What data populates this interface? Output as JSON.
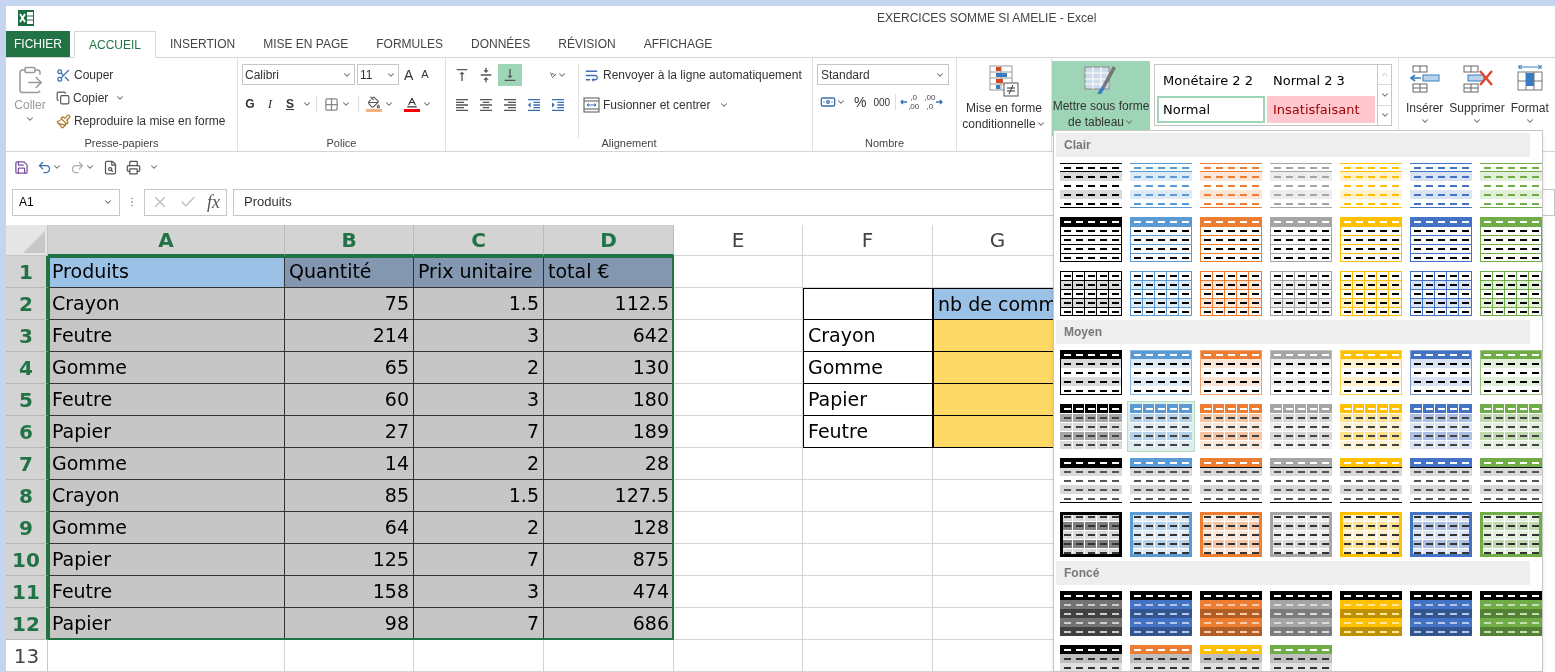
{
  "window": {
    "title": "EXERCICES SOMME SI AMELIE - Excel"
  },
  "tabs": [
    {
      "label": "FICHIER",
      "kind": "file",
      "selected": false
    },
    {
      "label": "ACCUEIL",
      "kind": "tab",
      "selected": true
    },
    {
      "label": "INSERTION",
      "kind": "tab",
      "selected": false
    },
    {
      "label": "MISE EN PAGE",
      "kind": "tab",
      "selected": false
    },
    {
      "label": "FORMULES",
      "kind": "tab",
      "selected": false
    },
    {
      "label": "DONNÉES",
      "kind": "tab",
      "selected": false
    },
    {
      "label": "RÉVISION",
      "kind": "tab",
      "selected": false
    },
    {
      "label": "AFFICHAGE",
      "kind": "tab",
      "selected": false
    }
  ],
  "ribbon": {
    "clipboard": {
      "label": "Presse-papiers",
      "paste": {
        "label": "Coller",
        "disabled": true
      },
      "cut": "Couper",
      "copy": "Copier",
      "format_painter": "Reproduire la mise en forme"
    },
    "font": {
      "label": "Police",
      "family": "Calibri",
      "size": "11",
      "grow": "A",
      "shrink": "A",
      "bold": "G",
      "italic": "I",
      "underline": "S"
    },
    "alignment": {
      "label": "Alignement",
      "vertical": [
        {
          "kind": "top",
          "selected": false
        },
        {
          "kind": "middle",
          "selected": false
        },
        {
          "kind": "bottom",
          "selected": true
        }
      ],
      "wrap": "Renvoyer à la ligne automatiquement",
      "merge": "Fusionner et centrer"
    },
    "number": {
      "label": "Nombre",
      "format": "Standard",
      "percent": "%",
      "thousands": "000",
      "decimals": [
        {
          "kind": "increase",
          "top": ",0",
          "bottom": ",00"
        },
        {
          "kind": "decrease",
          "top": ",00",
          "bottom": ",0"
        }
      ]
    },
    "conditional_format": {
      "lines": [
        "Mise en forme",
        "conditionnelle"
      ]
    },
    "format_as_table": {
      "lines": [
        "Mettre sous forme",
        "de tableau"
      ],
      "expanded": true
    },
    "cell_styles": [
      {
        "label": "Monétaire 2 2",
        "kind": "plain",
        "selected": false
      },
      {
        "label": "Normal 2 3",
        "kind": "plain",
        "selected": false
      },
      {
        "label": "Normal",
        "kind": "plain",
        "selected": true
      },
      {
        "label": "Insatisfaisant",
        "kind": "bad",
        "selected": false
      }
    ],
    "cells": [
      {
        "label": "Insérer",
        "kind": "insert"
      },
      {
        "label": "Supprimer",
        "kind": "delete"
      },
      {
        "label": "Format",
        "kind": "format"
      }
    ]
  },
  "formula_bar": {
    "name_box": "A1",
    "fx": "fx",
    "value": "Produits"
  },
  "sheet": {
    "columns": [
      {
        "label": "A",
        "selected": true
      },
      {
        "label": "B",
        "selected": true
      },
      {
        "label": "C",
        "selected": true
      },
      {
        "label": "D",
        "selected": true
      },
      {
        "label": "E",
        "selected": false
      },
      {
        "label": "F",
        "selected": false
      },
      {
        "label": "G",
        "selected": false
      }
    ],
    "rows": [
      {
        "label": "1",
        "selected": true
      },
      {
        "label": "2",
        "selected": true
      },
      {
        "label": "3",
        "selected": true
      },
      {
        "label": "4",
        "selected": true
      },
      {
        "label": "5",
        "selected": true
      },
      {
        "label": "6",
        "selected": true
      },
      {
        "label": "7",
        "selected": true
      },
      {
        "label": "8",
        "selected": true
      },
      {
        "label": "9",
        "selected": true
      },
      {
        "label": "10",
        "selected": true
      },
      {
        "label": "11",
        "selected": true
      },
      {
        "label": "12",
        "selected": true
      },
      {
        "label": "13",
        "selected": false
      }
    ],
    "main_table": {
      "selected": true,
      "header": [
        {
          "text": "Produits",
          "active": true
        },
        {
          "text": "Quantité",
          "active": false
        },
        {
          "text": "Prix unitaire",
          "active": false
        },
        {
          "text": "total €",
          "active": false
        }
      ],
      "rows": [
        [
          "Crayon",
          "75",
          "1.5",
          "112.5"
        ],
        [
          "Feutre",
          "214",
          "3",
          "642"
        ],
        [
          "Gomme",
          "65",
          "2",
          "130"
        ],
        [
          "Feutre",
          "60",
          "3",
          "180"
        ],
        [
          "Papier",
          "27",
          "7",
          "189"
        ],
        [
          "Gomme",
          "14",
          "2",
          "28"
        ],
        [
          "Crayon",
          "85",
          "1.5",
          "127.5"
        ],
        [
          "Gomme",
          "64",
          "2",
          "128"
        ],
        [
          "Papier",
          "125",
          "7",
          "875"
        ],
        [
          "Feutre",
          "158",
          "3",
          "474"
        ],
        [
          "Papier",
          "98",
          "7",
          "686"
        ]
      ]
    },
    "summary_table": {
      "header": "nb de comm",
      "items": [
        "Crayon",
        "Gomme",
        "Papier",
        "Feutre"
      ]
    }
  },
  "table_styles_menu": {
    "sections": [
      {
        "title": "Clair",
        "rows": [
          {
            "kind": "light-banded",
            "items": [
              {
                "color": "#000000",
                "selected": false
              },
              {
                "color": "#5b9bd5",
                "selected": false
              },
              {
                "color": "#ed7d31",
                "selected": false
              },
              {
                "color": "#a5a5a5",
                "selected": false
              },
              {
                "color": "#ffc000",
                "selected": false
              },
              {
                "color": "#4472c4",
                "selected": false
              },
              {
                "color": "#70ad47",
                "selected": false
              }
            ]
          },
          {
            "kind": "light-header",
            "items": [
              {
                "color": "#000000",
                "selected": false
              },
              {
                "color": "#5b9bd5",
                "selected": false
              },
              {
                "color": "#ed7d31",
                "selected": false
              },
              {
                "color": "#a5a5a5",
                "selected": false
              },
              {
                "color": "#ffc000",
                "selected": false
              },
              {
                "color": "#4472c4",
                "selected": false
              },
              {
                "color": "#70ad47",
                "selected": false
              }
            ]
          },
          {
            "kind": "light-grid",
            "items": [
              {
                "color": "#000000",
                "selected": false
              },
              {
                "color": "#5b9bd5",
                "selected": false
              },
              {
                "color": "#ed7d31",
                "selected": false
              },
              {
                "color": "#a5a5a5",
                "selected": false
              },
              {
                "color": "#ffc000",
                "selected": false
              },
              {
                "color": "#4472c4",
                "selected": false
              },
              {
                "color": "#70ad47",
                "selected": false
              }
            ]
          }
        ]
      },
      {
        "title": "Moyen",
        "rows": [
          {
            "kind": "medium-banded",
            "items": [
              {
                "color": "#000000",
                "selected": false
              },
              {
                "color": "#5b9bd5",
                "selected": false
              },
              {
                "color": "#ed7d31",
                "selected": false
              },
              {
                "color": "#a5a5a5",
                "selected": false
              },
              {
                "color": "#ffc000",
                "selected": false
              },
              {
                "color": "#4472c4",
                "selected": false
              },
              {
                "color": "#70ad47",
                "selected": false
              }
            ]
          },
          {
            "kind": "medium-grid-header",
            "items": [
              {
                "color": "#000000",
                "selected": false
              },
              {
                "color": "#5b9bd5",
                "selected": true
              },
              {
                "color": "#ed7d31",
                "selected": false
              },
              {
                "color": "#a5a5a5",
                "selected": false
              },
              {
                "color": "#ffc000",
                "selected": false
              },
              {
                "color": "#4472c4",
                "selected": false
              },
              {
                "color": "#70ad47",
                "selected": false
              }
            ]
          },
          {
            "kind": "medium-header-line",
            "items": [
              {
                "color": "#000000",
                "selected": false
              },
              {
                "color": "#5b9bd5",
                "selected": false
              },
              {
                "color": "#ed7d31",
                "selected": false
              },
              {
                "color": "#a5a5a5",
                "selected": false
              },
              {
                "color": "#ffc000",
                "selected": false
              },
              {
                "color": "#4472c4",
                "selected": false
              },
              {
                "color": "#70ad47",
                "selected": false
              }
            ]
          },
          {
            "kind": "medium-grid-tinted",
            "items": [
              {
                "color": "#000000",
                "selected": false
              },
              {
                "color": "#5b9bd5",
                "selected": false
              },
              {
                "color": "#ed7d31",
                "selected": false
              },
              {
                "color": "#a5a5a5",
                "selected": false
              },
              {
                "color": "#ffc000",
                "selected": false
              },
              {
                "color": "#4472c4",
                "selected": false
              },
              {
                "color": "#70ad47",
                "selected": false
              }
            ]
          }
        ]
      },
      {
        "title": "Foncé",
        "rows": [
          {
            "kind": "dark",
            "items": [
              {
                "color": "#000000",
                "selected": false
              },
              {
                "color": "#4472c4",
                "selected": false
              },
              {
                "color": "#ed7d31",
                "selected": false
              },
              {
                "color": "#a5a5a5",
                "selected": false
              },
              {
                "color": "#ffc000",
                "selected": false
              },
              {
                "color": "#4472c4",
                "selected": false
              },
              {
                "color": "#70ad47",
                "selected": false
              }
            ]
          },
          {
            "kind": "dark-pair",
            "items": [
              {
                "color": "#000000",
                "selected": false
              },
              {
                "color": "#ed7d31",
                "selected": false
              },
              {
                "color": "#ffc000",
                "selected": false
              },
              {
                "color": "#70ad47",
                "selected": false
              }
            ]
          }
        ]
      }
    ]
  }
}
